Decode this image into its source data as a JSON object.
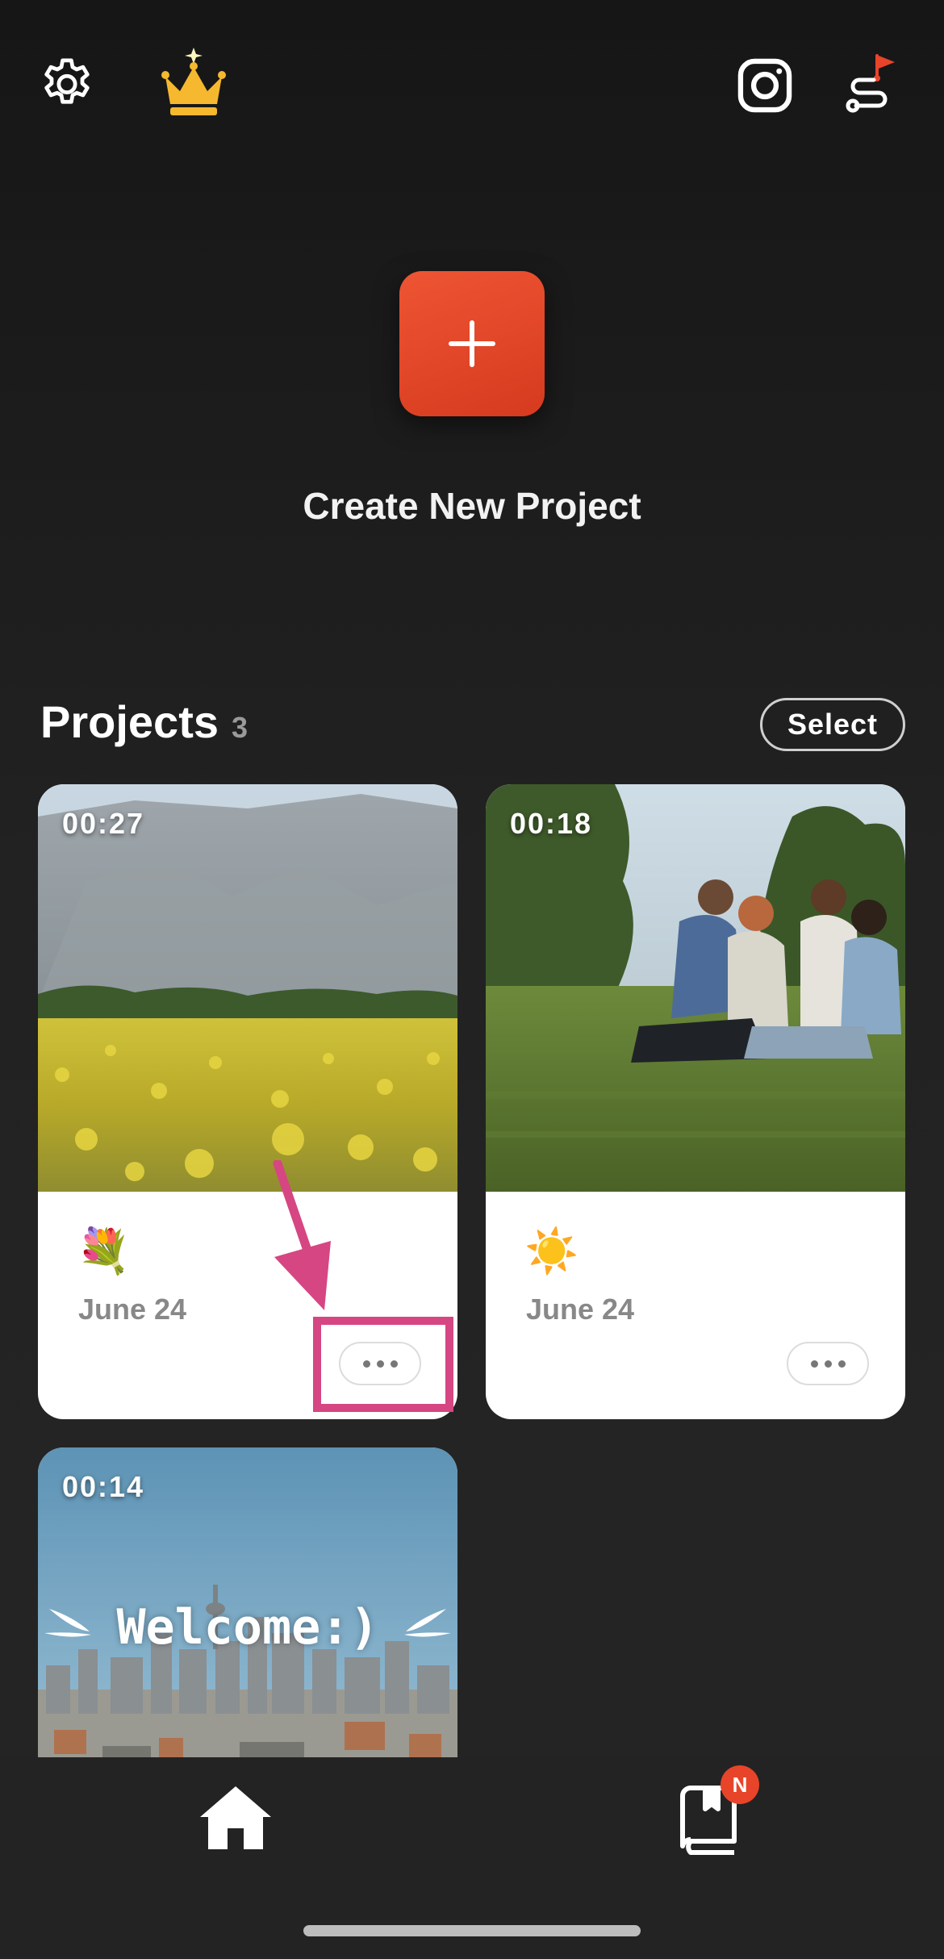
{
  "top_bar": {
    "settings_icon": "gear-icon",
    "premium_icon": "crown-icon",
    "instagram_icon": "instagram-icon",
    "route_icon": "route-flag-icon"
  },
  "create": {
    "button_icon": "plus-icon",
    "label": "Create New Project",
    "accent": "#e04a2a"
  },
  "projects": {
    "title": "Projects",
    "count": "3",
    "select_label": "Select",
    "items": [
      {
        "duration": "00:27",
        "emoji": "💐",
        "date": "June 24",
        "thumbnail": "mountain-flower-field"
      },
      {
        "duration": "00:18",
        "emoji": "☀️",
        "date": "June 24",
        "thumbnail": "friends-picnic-grass"
      },
      {
        "duration": "00:14",
        "overlay_text": "Welcome:)",
        "thumbnail": "city-skyline"
      }
    ]
  },
  "annotation": {
    "highlight_color": "#d64682"
  },
  "tab_bar": {
    "home_icon": "home-icon",
    "book_icon": "book-icon",
    "badge": "N"
  }
}
